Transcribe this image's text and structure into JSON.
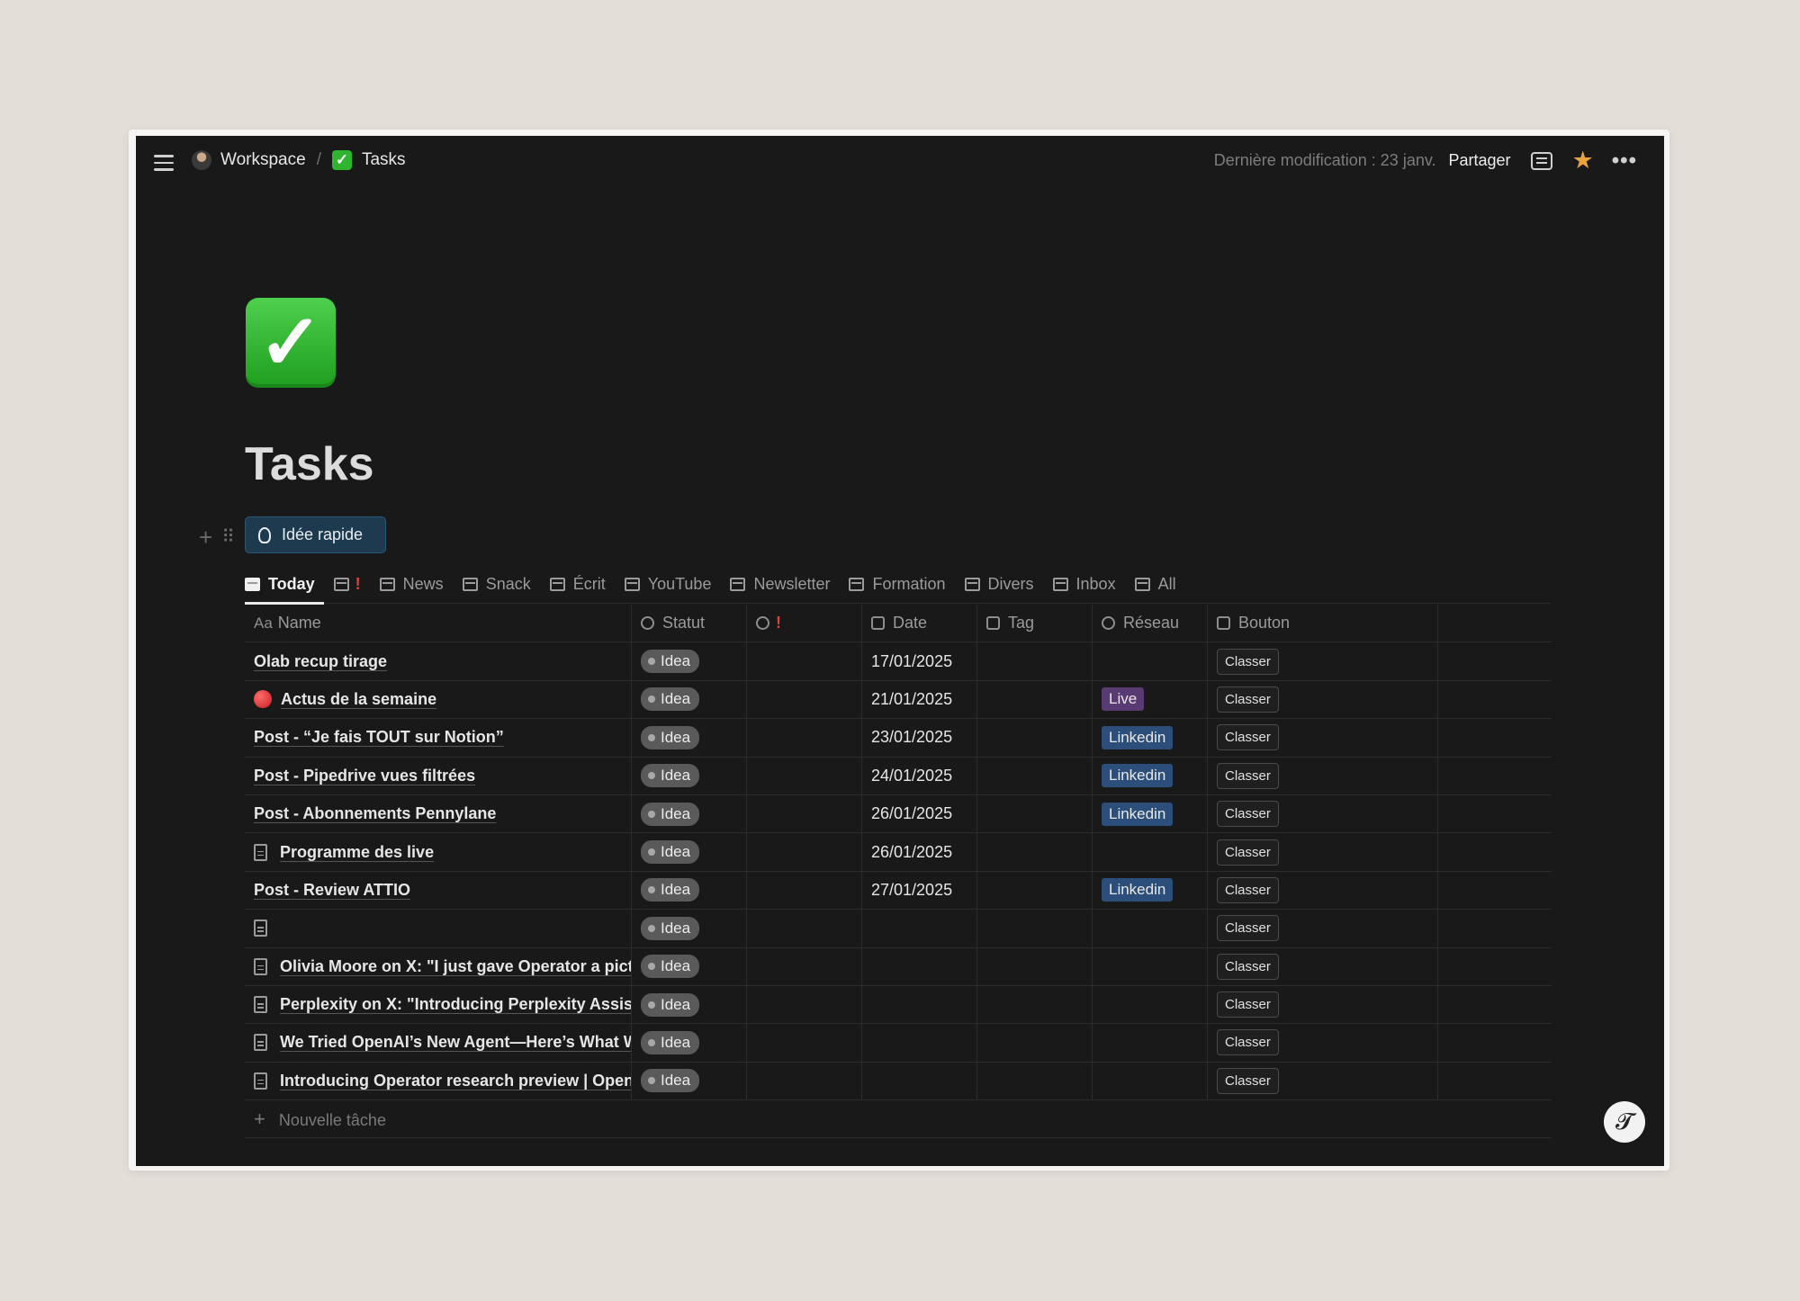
{
  "topbar": {
    "workspace": "Workspace",
    "separator": "/",
    "page": "Tasks",
    "last_modified": "Dernière modification : 23 janv.",
    "share_label": "Partager",
    "icons": [
      "menu-icon",
      "comment-icon",
      "star-icon",
      "more-icon"
    ],
    "star_color": "#e9a33b"
  },
  "page": {
    "icon": "✓",
    "title": "Tasks",
    "quick_button": "Idée rapide"
  },
  "tabs": [
    {
      "label": "Today",
      "icon": "calendar-icon",
      "active": true
    },
    {
      "label": "",
      "icon": "table-icon",
      "suffix": "!"
    },
    {
      "label": "News",
      "icon": "table-icon"
    },
    {
      "label": "Snack",
      "icon": "burger-icon"
    },
    {
      "label": "Écrit",
      "icon": "pencil-icon"
    },
    {
      "label": "YouTube",
      "icon": "camera-icon"
    },
    {
      "label": "Newsletter",
      "icon": "mail-icon"
    },
    {
      "label": "Formation",
      "icon": "table-icon"
    },
    {
      "label": "Divers",
      "icon": "pin-icon"
    },
    {
      "label": "Inbox",
      "icon": "folder-icon"
    },
    {
      "label": "All",
      "icon": "table-icon"
    }
  ],
  "table": {
    "headers": {
      "name_prefix": "Aa",
      "name": "Name",
      "statut": "Statut",
      "priority": "!",
      "date": "Date",
      "tag": "Tag",
      "reseau": "Réseau",
      "bouton": "Bouton"
    },
    "rows": [
      {
        "name": "Olab recup tirage",
        "icon": "",
        "statut": "Idea",
        "date": "17/01/2025",
        "reseau": "",
        "bouton": "Classer"
      },
      {
        "name": "Actus de la semaine",
        "icon": "red-dot",
        "statut": "Idea",
        "date": "21/01/2025",
        "reseau": "Live",
        "bouton": "Classer"
      },
      {
        "name": "Post - “Je fais TOUT sur Notion”",
        "icon": "",
        "statut": "Idea",
        "date": "23/01/2025",
        "reseau": "Linkedin",
        "bouton": "Classer"
      },
      {
        "name": "Post - Pipedrive vues filtrées",
        "icon": "",
        "statut": "Idea",
        "date": "24/01/2025",
        "reseau": "Linkedin",
        "bouton": "Classer"
      },
      {
        "name": "Post - Abonnements Pennylane",
        "icon": "",
        "statut": "Idea",
        "date": "26/01/2025",
        "reseau": "Linkedin",
        "bouton": "Classer"
      },
      {
        "name": "Programme des live",
        "icon": "doc",
        "statut": "Idea",
        "date": "26/01/2025",
        "reseau": "",
        "bouton": "Classer"
      },
      {
        "name": "Post - Review ATTIO",
        "icon": "",
        "statut": "Idea",
        "date": "27/01/2025",
        "reseau": "Linkedin",
        "bouton": "Classer"
      },
      {
        "name": "",
        "icon": "doc",
        "statut": "Idea",
        "date": "",
        "reseau": "",
        "bouton": "Classer"
      },
      {
        "name": "Olivia Moore on X: \"I just gave Operator a pictu",
        "icon": "doc",
        "statut": "Idea",
        "date": "",
        "reseau": "",
        "bouton": "Classer"
      },
      {
        "name": "Perplexity on X: \"Introducing Perplexity Assist",
        "icon": "doc",
        "statut": "Idea",
        "date": "",
        "reseau": "",
        "bouton": "Classer"
      },
      {
        "name": "We Tried OpenAI’s New Agent—Here’s What W",
        "icon": "doc",
        "statut": "Idea",
        "date": "",
        "reseau": "",
        "bouton": "Classer"
      },
      {
        "name": "Introducing Operator research preview | OpenA",
        "icon": "doc",
        "statut": "Idea",
        "date": "",
        "reseau": "",
        "bouton": "Classer"
      }
    ],
    "new_row_label": "Nouvelle tâche"
  },
  "colors": {
    "live_tag": "#5a3a72",
    "linkedin_tag": "#2b4f7a",
    "background": "#191919"
  },
  "help_button": "?"
}
